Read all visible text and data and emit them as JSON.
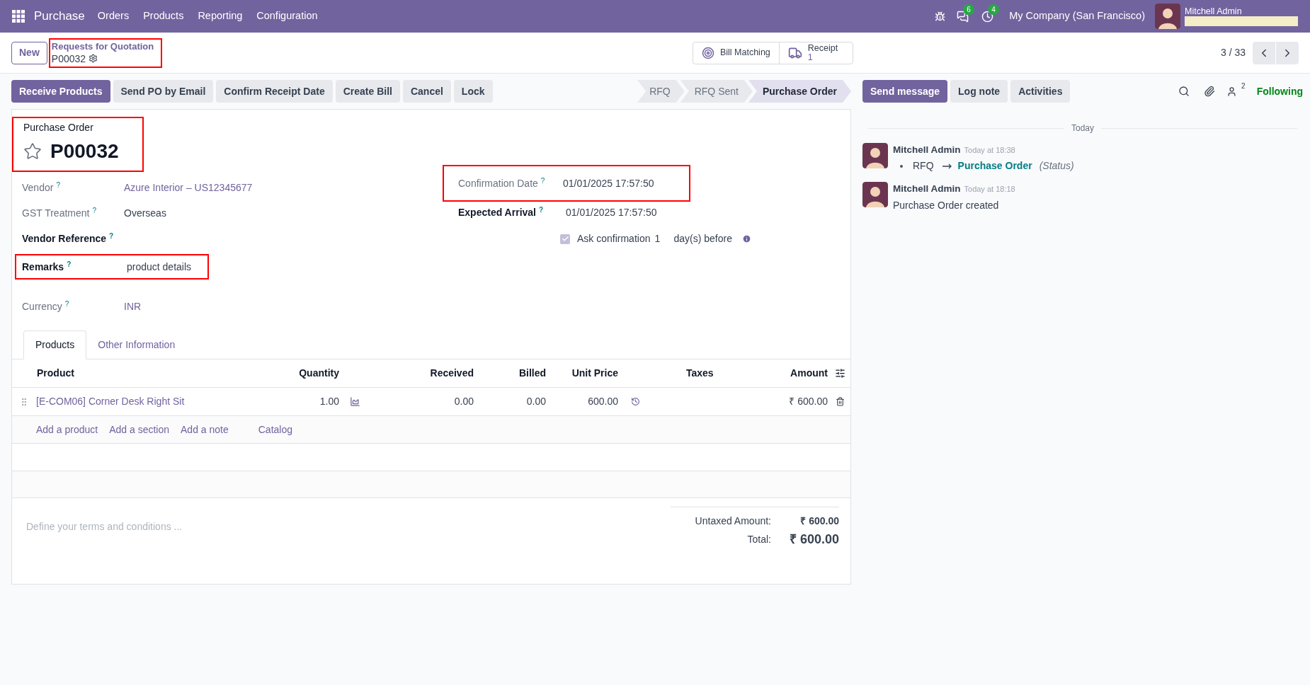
{
  "navbar": {
    "app_name": "Purchase",
    "menu": [
      "Orders",
      "Products",
      "Reporting",
      "Configuration"
    ],
    "badges": [
      {
        "kind": "chat",
        "count": "6"
      },
      {
        "kind": "activity",
        "count": "4"
      }
    ],
    "company": "My Company (San Francisco)",
    "user": "Mitchell Admin"
  },
  "control_panel": {
    "new_button": "New",
    "breadcrumb": {
      "parent": "Requests for Quotation",
      "current": "P00032",
      "highlighted": true
    },
    "smart_buttons": [
      {
        "kind": "matching",
        "label": "Bill Matching"
      },
      {
        "kind": "truck",
        "label": "Receipt",
        "value": "1"
      }
    ],
    "pager": "3 / 33"
  },
  "actions": [
    {
      "label": "Receive Products",
      "primary": true
    },
    {
      "label": "Send PO by Email",
      "primary": false
    },
    {
      "label": "Confirm Receipt Date",
      "primary": false
    },
    {
      "label": "Create Bill",
      "primary": false
    },
    {
      "label": "Cancel",
      "primary": false
    },
    {
      "label": "Lock",
      "primary": false
    }
  ],
  "statusbar": [
    {
      "label": "RFQ",
      "selected": false
    },
    {
      "label": "RFQ Sent",
      "selected": false
    },
    {
      "label": "Purchase Order",
      "selected": true
    }
  ],
  "form": {
    "title_label": "Purchase Order",
    "name": "P00032",
    "starred": false,
    "highlighted": true,
    "left_fields": [
      {
        "label": "Vendor",
        "help": "?",
        "value": "Azure Interior – US12345677",
        "kind": "link",
        "emphasized": false,
        "highlighted": false
      },
      {
        "label": "GST Treatment",
        "help": "?",
        "value": "Overseas",
        "kind": "text",
        "emphasized": false,
        "highlighted": false
      },
      {
        "label": "Vendor Reference",
        "help": "?",
        "kind": "text",
        "emphasized": true,
        "highlighted": false
      },
      {
        "label": "Remarks",
        "help": "?",
        "value": "product details",
        "kind": "text",
        "emphasized": true,
        "highlighted": true
      },
      {
        "label": "Currency",
        "help": "?",
        "value": "INR",
        "kind": "link",
        "emphasized": false,
        "highlighted": false
      }
    ],
    "right_fields": [
      {
        "label": "Confirmation Date",
        "help": "?",
        "value": "01/01/2025 17:57:50",
        "emphasized": false,
        "highlighted": true
      },
      {
        "label": "Expected Arrival",
        "help": "?",
        "value": "01/01/2025 17:57:50",
        "emphasized": true,
        "highlighted": false
      }
    ],
    "ask_confirmation": {
      "checked": true,
      "label": "Ask confirmation",
      "days": "1",
      "suffix": "day(s) before"
    },
    "tabs": [
      {
        "label": "Products",
        "selected": true
      },
      {
        "label": "Other Information",
        "selected": false
      }
    ],
    "table": {
      "columns": [
        "Product",
        "Quantity",
        "Received",
        "Billed",
        "Unit Price",
        "Taxes",
        "Amount"
      ],
      "rows": [
        {
          "product": "[E-COM06] Corner Desk Right Sit",
          "quantity": "1.00",
          "received": "0.00",
          "billed": "0.00",
          "unit_price": "600.00",
          "amount": "₹ 600.00"
        }
      ],
      "add_links": [
        "Add a product",
        "Add a section",
        "Add a note",
        "Catalog"
      ]
    },
    "terms_placeholder": "Define your terms and conditions ...",
    "totals": [
      {
        "label": "Untaxed Amount:",
        "value": "₹ 600.00"
      },
      {
        "label": "Total:",
        "value": "₹ 600.00"
      }
    ]
  },
  "chatter": {
    "buttons": [
      {
        "label": "Send message",
        "primary": true
      },
      {
        "label": "Log note",
        "primary": false
      },
      {
        "label": "Activities",
        "primary": false
      }
    ],
    "followers": "2",
    "following": "Following",
    "separator": "Today",
    "messages": [
      {
        "author": "Mitchell Admin",
        "time": "Today at 18:38",
        "kind": "tracking",
        "old": "RFQ",
        "new": "Purchase Order",
        "field": "(Status)"
      },
      {
        "author": "Mitchell Admin",
        "time": "Today at 18:18",
        "kind": "text",
        "body": "Purchase Order created"
      }
    ]
  }
}
